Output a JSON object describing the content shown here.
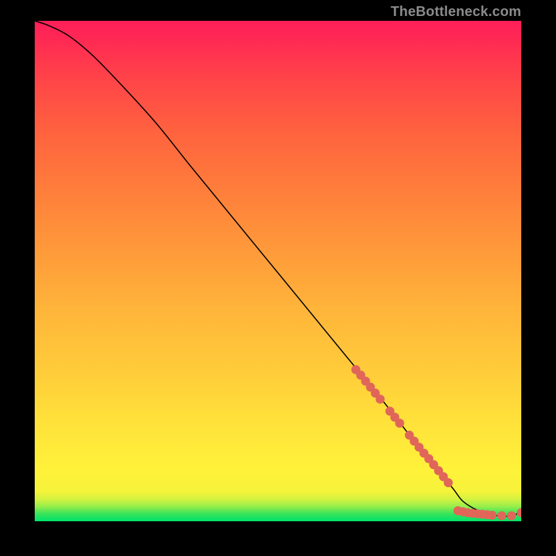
{
  "watermark": "TheBottleneck.com",
  "chart_data": {
    "type": "line",
    "title": "",
    "xlabel": "",
    "ylabel": "",
    "xlim": [
      0,
      100
    ],
    "ylim": [
      0,
      100
    ],
    "series": [
      {
        "name": "curve",
        "x": [
          0,
          3,
          7,
          12,
          18,
          25,
          32,
          40,
          48,
          56,
          64,
          72,
          78,
          83,
          86,
          88,
          91,
          94,
          97,
          100
        ],
        "y": [
          100,
          99,
          97,
          93,
          87,
          79.5,
          71,
          61.5,
          52,
          42.5,
          33,
          23.5,
          16,
          10,
          6.5,
          4.0,
          2.2,
          1.3,
          1.0,
          1.7
        ]
      }
    ],
    "markers": [
      {
        "x": 66,
        "y": 30.3
      },
      {
        "x": 67,
        "y": 29.2
      },
      {
        "x": 68,
        "y": 28.0
      },
      {
        "x": 69,
        "y": 26.8
      },
      {
        "x": 70,
        "y": 25.6
      },
      {
        "x": 71,
        "y": 24.4
      },
      {
        "x": 73,
        "y": 22.0
      },
      {
        "x": 74,
        "y": 20.8
      },
      {
        "x": 75,
        "y": 19.6
      },
      {
        "x": 77,
        "y": 17.2
      },
      {
        "x": 78,
        "y": 16.0
      },
      {
        "x": 79,
        "y": 14.8
      },
      {
        "x": 80,
        "y": 13.6
      },
      {
        "x": 81,
        "y": 12.5
      },
      {
        "x": 82,
        "y": 11.3
      },
      {
        "x": 83,
        "y": 10.1
      },
      {
        "x": 84,
        "y": 8.9
      },
      {
        "x": 85,
        "y": 7.7
      },
      {
        "x": 87,
        "y": 2.1
      },
      {
        "x": 88,
        "y": 1.9
      },
      {
        "x": 89,
        "y": 1.7
      },
      {
        "x": 90,
        "y": 1.6
      },
      {
        "x": 91,
        "y": 1.5
      },
      {
        "x": 92,
        "y": 1.4
      },
      {
        "x": 93,
        "y": 1.3
      },
      {
        "x": 94,
        "y": 1.2
      },
      {
        "x": 96,
        "y": 1.1
      },
      {
        "x": 98,
        "y": 1.1
      },
      {
        "x": 100,
        "y": 1.7
      }
    ],
    "marker_color": "#e06659",
    "curve_color": "#000000"
  }
}
